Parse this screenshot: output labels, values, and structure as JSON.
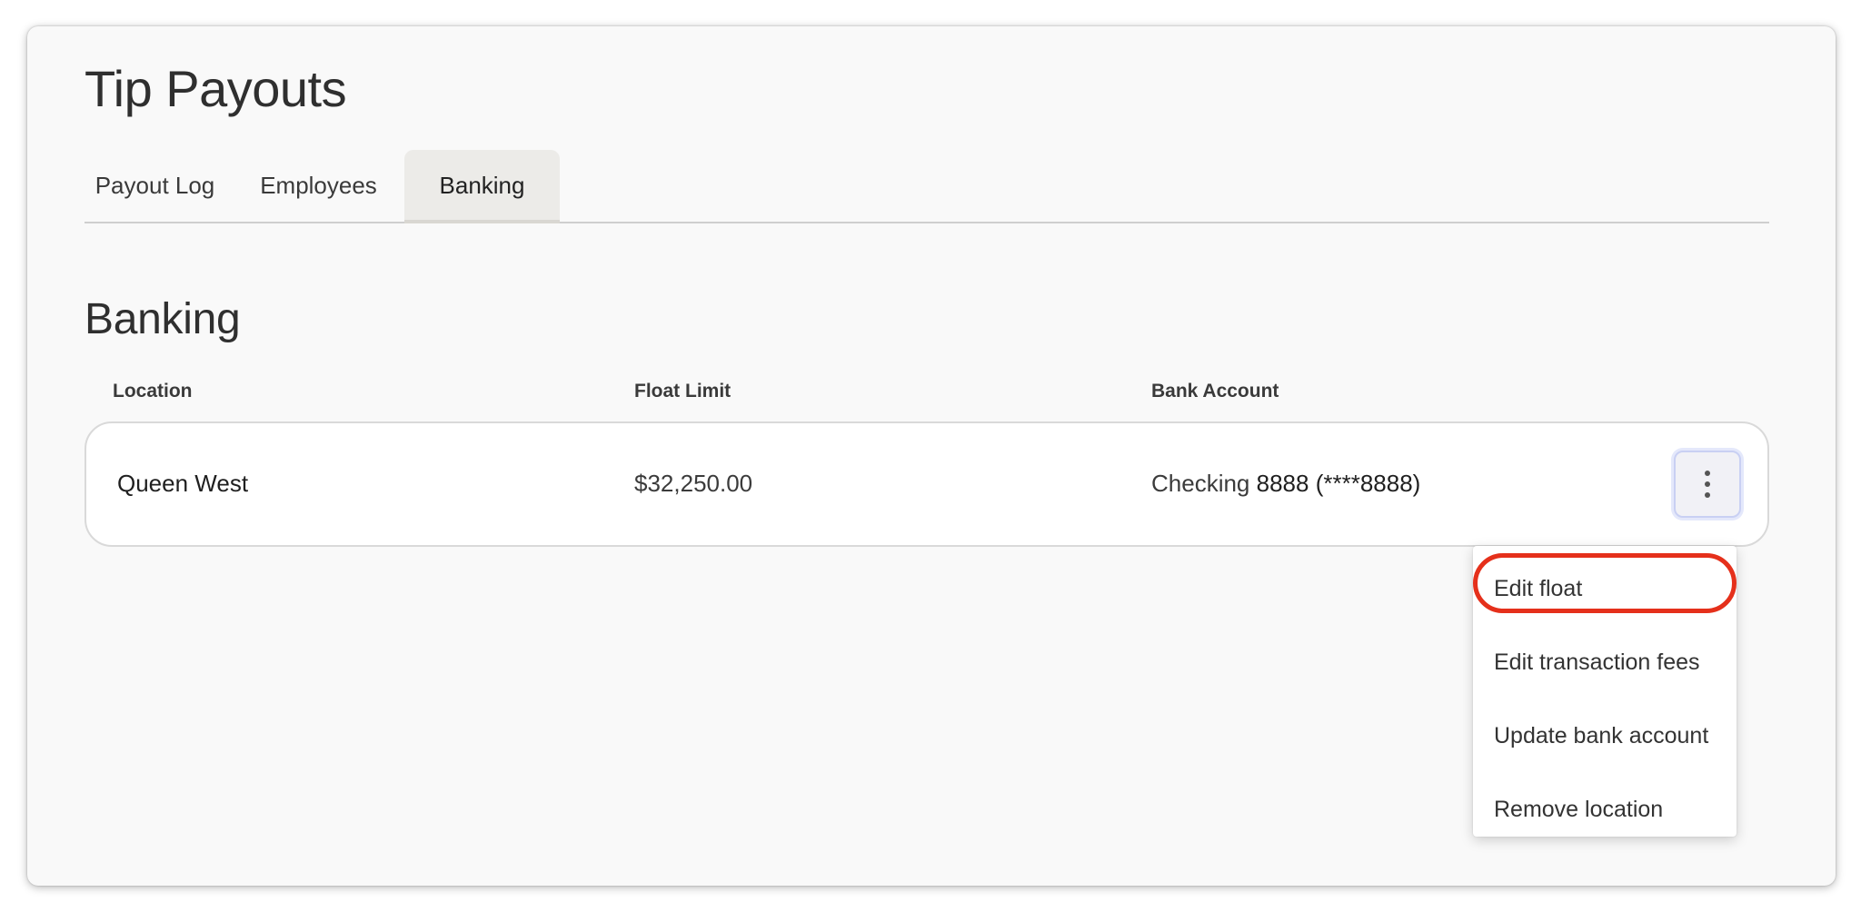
{
  "page": {
    "title": "Tip Payouts"
  },
  "tabs": [
    {
      "label": "Payout Log",
      "active": false
    },
    {
      "label": "Employees",
      "active": false
    },
    {
      "label": "Banking",
      "active": true
    }
  ],
  "banking": {
    "title": "Banking",
    "columns": [
      "Location",
      "Float Limit",
      "Bank Account"
    ],
    "rows": [
      {
        "location": "Queen West",
        "float_limit": "$32,250.00",
        "bank_account_type": "Checking",
        "bank_account_number": "8888 (****8888)"
      }
    ]
  },
  "row_menu": {
    "icon": "kebab-menu-icon",
    "items": [
      "Edit float",
      "Edit transaction fees",
      "Update bank account",
      "Remove location"
    ],
    "highlighted_item": "Edit float"
  },
  "colors": {
    "active_tab_bg": "#ecebe8",
    "highlight": "#e5301b",
    "kebab_focus": "#c9d0f3"
  }
}
